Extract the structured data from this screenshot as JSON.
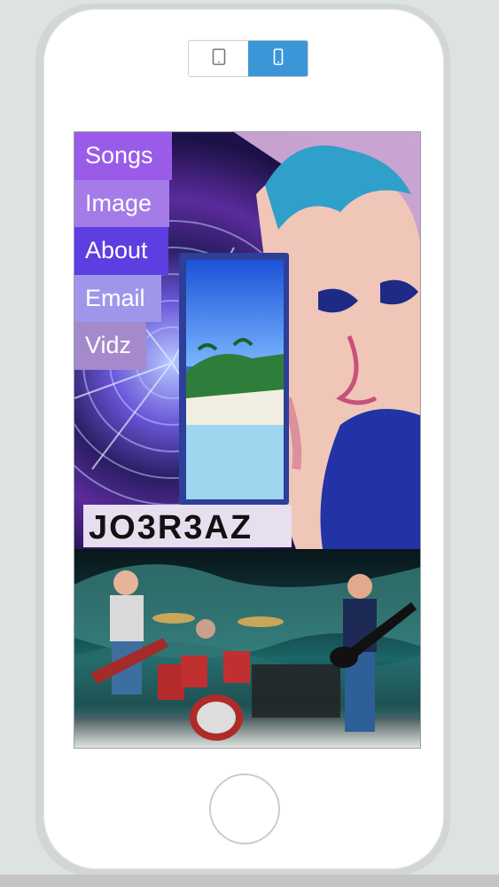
{
  "view_toggle": {
    "tablet_icon": "tablet-icon",
    "phone_icon": "phone-icon",
    "active": "phone"
  },
  "nav": {
    "items": [
      {
        "label": "Songs"
      },
      {
        "label": "Image"
      },
      {
        "label": "About"
      },
      {
        "label": "Email"
      },
      {
        "label": "Vidz"
      }
    ]
  },
  "hero": {
    "logo_text": "JO3R3AZ"
  },
  "colors": {
    "toggle_active": "#3c95d6",
    "nav_songs": "#9a5ce8",
    "nav_image": "#a57be8",
    "nav_about": "#5d3ee0",
    "nav_email": "#9f96ec",
    "nav_vidz": "#a48acb"
  }
}
